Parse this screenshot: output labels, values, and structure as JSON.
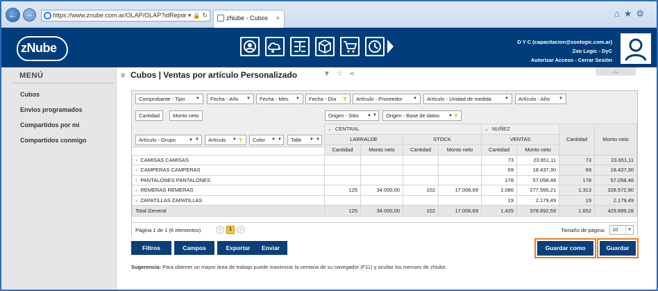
{
  "browser": {
    "url": "https://www.znube.com.ar/OLAP/OLAP?idRepor",
    "tab_title": "zNube - Cubos",
    "tab_close": "×"
  },
  "header": {
    "logo_text": "zNube",
    "user_name": "D Y C (capacitacion@zoologic.com.ar)",
    "company": "Zoo Logic - DyC",
    "actions": "Autorizar Acceso - Cerrar Sesión"
  },
  "sidebar": {
    "title": "MENÚ",
    "items": [
      "Cubos",
      "Envios programados",
      "Compartidos por mi",
      "Compartidos conmigo"
    ]
  },
  "page": {
    "title": "Cubos | Ventas por artículo Personalizado"
  },
  "pivot": {
    "filters": [
      "Comprobante - Tipo",
      "Fecha - Año",
      "Fecha - Mes",
      "Fecha - Día",
      "Artículo - Proveedor",
      "Artículo - Unidad de medida",
      "Artículo - Año"
    ],
    "data_fields": [
      "Cantidad",
      "Monto neto"
    ],
    "column_fields": [
      "Origen - Sitio",
      "Origen - Base de datos"
    ],
    "row_fields": [
      "Artículo - Grupo",
      "Artículo",
      "Color",
      "Talle"
    ],
    "col_groups": {
      "central": "CENTRAL",
      "nunez": "NUÑEZ",
      "larralde": "LARRALDE",
      "stock": "STOCK",
      "ventas": "VENTAS",
      "cantidad": "Cantidad",
      "monto": "Monto neto"
    },
    "measures": [
      "Cantidad",
      "Monto neto",
      "Cantidad",
      "Monto neto",
      "Cantidad",
      "Monto neto"
    ],
    "rows": [
      {
        "label": "CAMISAS CAMISAS",
        "cells": [
          "",
          "",
          "",
          "",
          "73",
          "23.651,11",
          "73",
          "23.651,11"
        ]
      },
      {
        "label": "CAMPERAS CAMPERAS",
        "cells": [
          "",
          "",
          "",
          "",
          "69",
          "18.437,30",
          "69",
          "18.437,30"
        ]
      },
      {
        "label": "PANTALONES PANTALONES",
        "cells": [
          "",
          "",
          "",
          "",
          "178",
          "57.058,48",
          "178",
          "57.058,48"
        ]
      },
      {
        "label": "REMERAS REMERAS",
        "cells": [
          "125",
          "34.000,00",
          "102",
          "17.006,69",
          "1.086",
          "277.566,21",
          "1.313",
          "328.572,90"
        ]
      },
      {
        "label": "ZAPATILLAS ZAPATILLAS",
        "cells": [
          "",
          "",
          "",
          "",
          "19",
          "2.179,49",
          "19",
          "2.179,49"
        ]
      }
    ],
    "total": {
      "label": "Total General",
      "cells": [
        "125",
        "34.000,00",
        "102",
        "17.006,69",
        "1.425",
        "378.892,59",
        "1.652",
        "429.899,28"
      ]
    },
    "pager_info": "Página 1 de 1 (6 elementos)",
    "current_page": "1",
    "page_size_label": "Tamaño de página:",
    "page_size": "10"
  },
  "actions": {
    "filtros": "Filtros",
    "campos": "Campos",
    "exportar": "Exportar",
    "enviar": "Enviar",
    "guardar_como": "Guardar como",
    "guardar": "Guardar"
  },
  "hint": {
    "label": "Sugerencia:",
    "text": "Para obtener un mayor área de trabajo puede maximizar la ventana de su navegador (F11) y ocultar los menues de zNube."
  },
  "colors": {
    "header_bg": "#003d7a",
    "button_bg": "#0b3f7a",
    "highlight": "#f07a18",
    "page_active": "#f7c343"
  }
}
